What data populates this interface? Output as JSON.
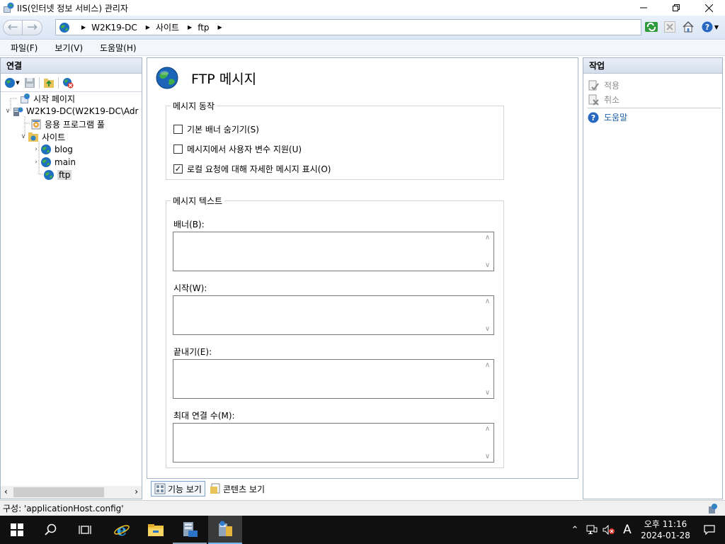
{
  "window": {
    "title": "IIS(인터넷 정보 서비스) 관리자"
  },
  "address": {
    "crumbs": [
      "W2K19-DC",
      "사이트",
      "ftp"
    ]
  },
  "menu": {
    "items": [
      "파일(F)",
      "보기(V)",
      "도움말(H)"
    ]
  },
  "connections": {
    "header": "연결",
    "tree": {
      "start_page": "시작 페이지",
      "server": "W2K19-DC(W2K19-DC\\Adr",
      "app_pools": "응용 프로그램 풀",
      "sites": "사이트",
      "site_blog": "blog",
      "site_main": "main",
      "site_ftp": "ftp"
    }
  },
  "main": {
    "title": "FTP 메시지",
    "behavior_group": {
      "legend": "메시지 동작",
      "options": [
        {
          "label": "기본 배너 숨기기(S)",
          "checked": false
        },
        {
          "label": "메시지에서 사용자 변수 지원(U)",
          "checked": false
        },
        {
          "label": "로컬 요청에 대해 자세한 메시지 표시(O)",
          "checked": true
        }
      ]
    },
    "text_group": {
      "legend": "메시지 텍스트",
      "fields": {
        "banner": {
          "label": "배너(B):",
          "value": ""
        },
        "welcome": {
          "label": "시작(W):",
          "value": ""
        },
        "exit": {
          "label": "끝내기(E):",
          "value": ""
        },
        "max_connections": {
          "label": "최대 연결 수(M):",
          "value": ""
        }
      }
    }
  },
  "views": {
    "features": "기능 보기",
    "content": "콘텐츠 보기"
  },
  "actions": {
    "header": "작업",
    "apply": "적용",
    "cancel": "취소",
    "help": "도움말"
  },
  "status": {
    "text": "구성: 'applicationHost.config'"
  },
  "taskbar": {
    "clock_time": "오후 11:16",
    "clock_date": "2024-01-28",
    "ime": "A"
  }
}
